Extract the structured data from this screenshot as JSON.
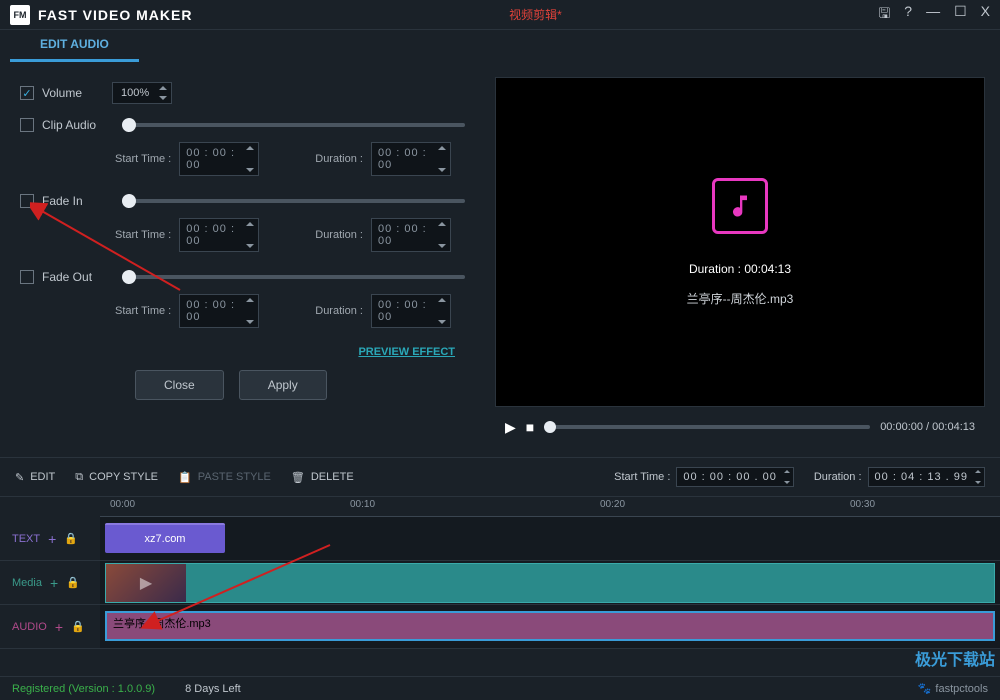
{
  "titlebar": {
    "logo": "FM",
    "app": "FAST VIDEO MAKER",
    "center": "视频剪辑*"
  },
  "tab": {
    "label": "EDIT AUDIO"
  },
  "audio": {
    "volume_label": "Volume",
    "volume_value": "100%",
    "clip_label": "Clip Audio",
    "fadein_label": "Fade In",
    "fadeout_label": "Fade Out",
    "start_label": "Start Time :",
    "duration_label": "Duration :",
    "time_zero": "00 : 00 : 00",
    "preview_link": "PREVIEW EFFECT",
    "close": "Close",
    "apply": "Apply"
  },
  "preview": {
    "duration_label": "Duration : 00:04:13",
    "filename": "兰亭序--周杰伦.mp3",
    "time": "00:00:00 /  00:04:13"
  },
  "toolbar": {
    "edit": "EDIT",
    "copy": "COPY STYLE",
    "paste": "PASTE STYLE",
    "delete": "DELETE",
    "start_label": "Start Time :",
    "start_val": "00 : 00 : 00 . 00",
    "dur_label": "Duration :",
    "dur_val": "00 : 04 : 13 . 99"
  },
  "timeline": {
    "ticks": [
      "00:00",
      "00:10",
      "00:20",
      "00:30"
    ],
    "tracks": {
      "text": "TEXT",
      "media": "Media",
      "audio": "AUDIO"
    },
    "text_clip": "xz7.com",
    "audio_clip": "兰亭序--周杰伦.mp3"
  },
  "status": {
    "registered": "Registered (Version : 1.0.0.9)",
    "days": "8 Days Left",
    "brand": "fastpctools"
  },
  "watermark": {
    "main": "极光下载站"
  }
}
